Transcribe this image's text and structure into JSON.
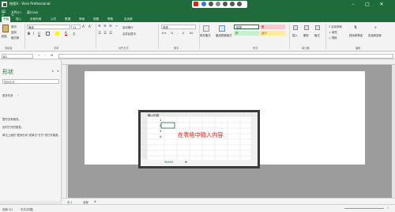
{
  "app": {
    "title": "绘图4 - Visio Professional",
    "menu": [
      "文件(F)",
      "窗口(W)"
    ]
  },
  "tabs": [
    "开始",
    "插入",
    "页面布局",
    "公式",
    "数据",
    "审阅",
    "视图",
    "帮助",
    "告诉我"
  ],
  "ribbon": {
    "clipboard": {
      "cut": "剪切",
      "copy": "复制",
      "paste": "粘贴",
      "format_painter": "格式刷",
      "group": "剪贴板"
    },
    "font": {
      "name": "等线",
      "size": "11",
      "group": "字体"
    },
    "alignment": {
      "wrap": "自动换行",
      "merge": "合并后居中",
      "group": "对齐方式"
    },
    "number": {
      "format": "常规",
      "group": "数字"
    },
    "styles": {
      "conditional": "条件格式",
      "table": "套用表格格式",
      "normal": "常规",
      "bad": "差",
      "good": "好",
      "neutral": "适中",
      "group": "样式"
    },
    "cells": {
      "insert": "插入",
      "delete": "删除",
      "format": "格式",
      "group": "单元格"
    },
    "editing": {
      "autosum": "自动求和",
      "fill": "填充",
      "clear": "清除",
      "sort": "排序和筛选",
      "find": "查找和选择",
      "group": "编辑"
    }
  },
  "formula_bar": {
    "name_box": "B3",
    "fx": "fx"
  },
  "shapes_pane": {
    "title": "形状",
    "search_placeholder": "搜索形状",
    "more": "更多形状",
    "no_stencils": "暂时没有模具。",
    "hint1": "实时打开的模具。",
    "hint2": "单击上面的\"更多形状\"或单击\"打开\"来打开模具。"
  },
  "excel": {
    "header_cell": "输入内容",
    "values": [
      "1",
      "2",
      "3",
      "4"
    ],
    "sheet_tab": "Sheet1",
    "note": "在表格中输入内容"
  },
  "page_tabs": {
    "page": "页-1",
    "all": "全部"
  },
  "status": {
    "page": "页面 1/1",
    "lang": "中文(中国)"
  },
  "colors": {
    "accent": "#1f6b3b",
    "note": "#e0241b",
    "bad_bg": "#ffc7ce",
    "good_bg": "#c6efce",
    "neutral_bg": "#ffeb9c"
  }
}
